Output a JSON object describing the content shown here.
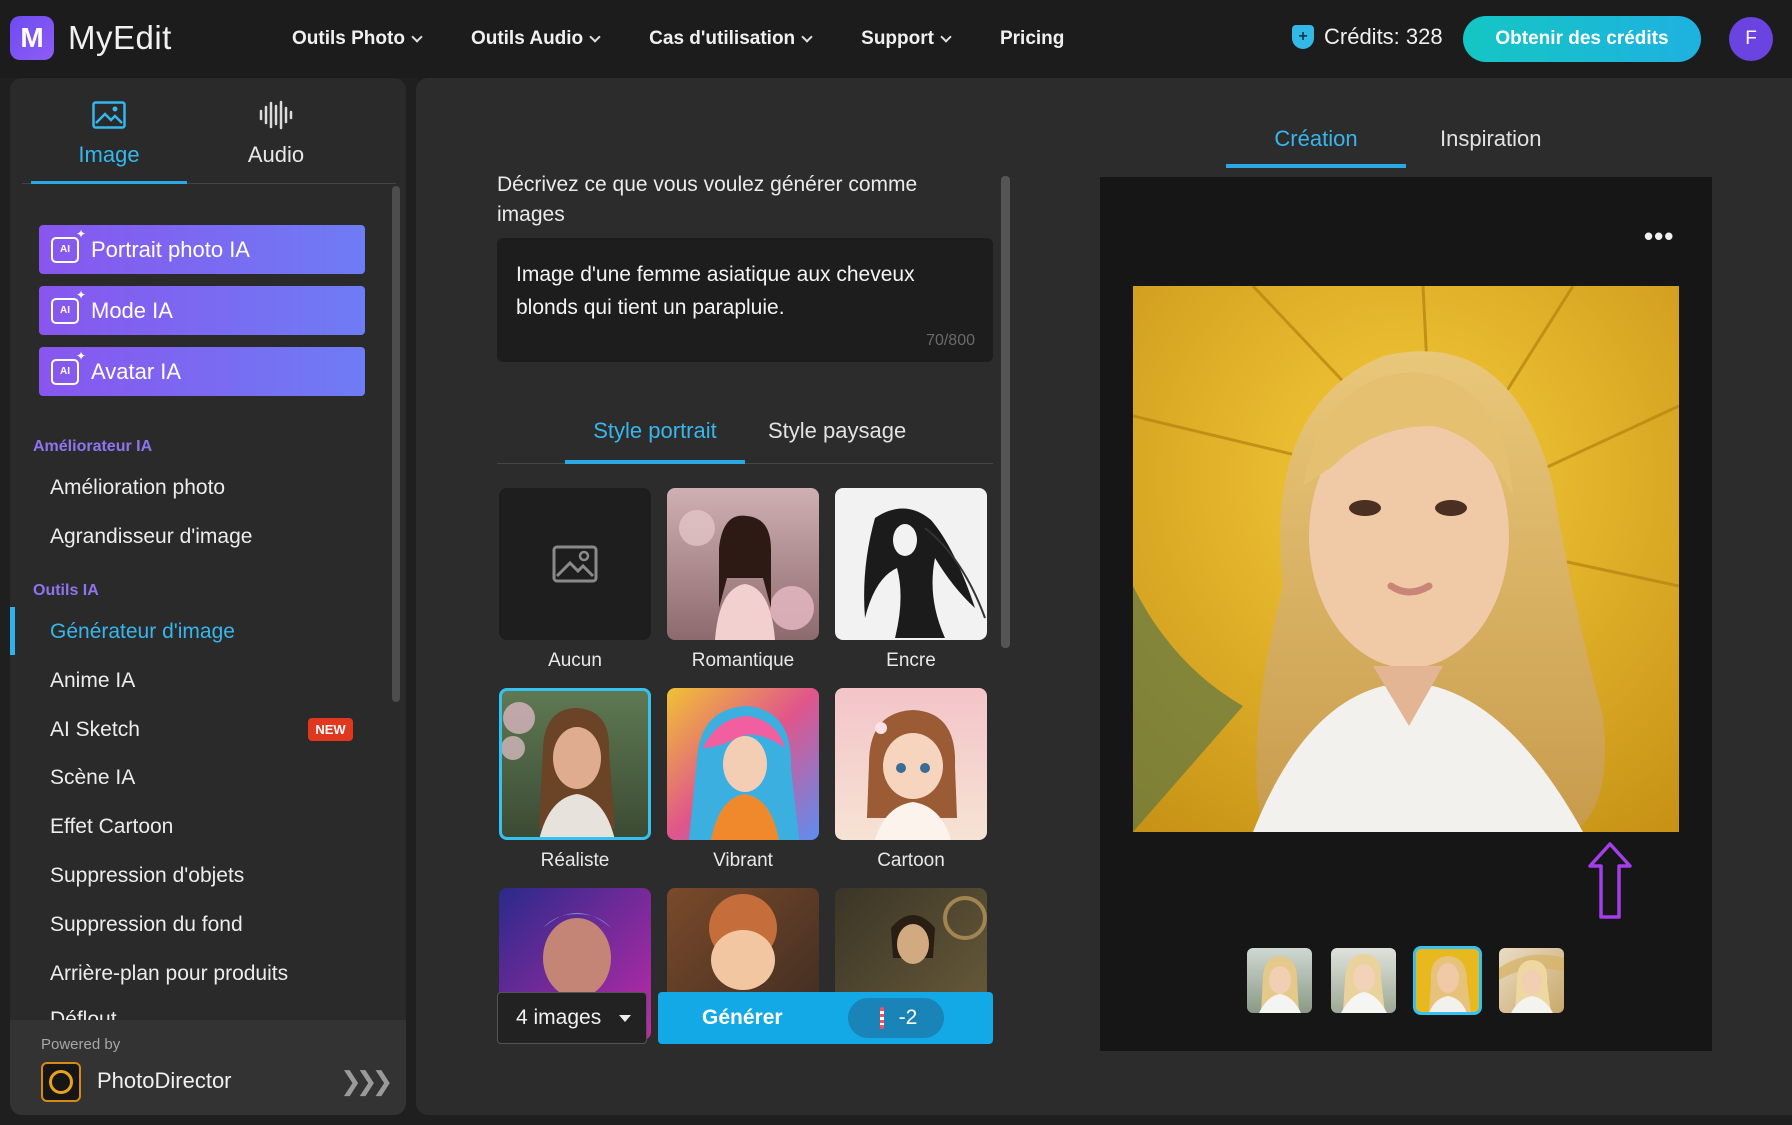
{
  "app": {
    "name": "MyEdit",
    "logo_letter": "M"
  },
  "nav": {
    "items": [
      "Outils Photo",
      "Outils Audio",
      "Cas d'utilisation",
      "Support"
    ],
    "pricing": "Pricing"
  },
  "header": {
    "credits": "Crédits: 328",
    "get_credits": "Obtenir des crédits",
    "avatar_letter": "F"
  },
  "sidebar": {
    "tabs": {
      "image": "Image",
      "audio": "Audio"
    },
    "ai_buttons": [
      "Portrait photo IA",
      "Mode IA",
      "Avatar IA"
    ],
    "ai_icon_text": "AI",
    "section_enhancer": "Améliorateur IA",
    "enhancer_items": [
      "Amélioration photo",
      "Agrandisseur d'image"
    ],
    "section_tools": "Outils IA",
    "tool_items": [
      "Générateur d'image",
      "Anime IA",
      "AI Sketch",
      "Scène IA",
      "Effet Cartoon",
      "Suppression d'objets",
      "Suppression du fond",
      "Arrière-plan pour produits",
      "Déflout..."
    ],
    "new_badge": "NEW",
    "powered_by": "Powered by",
    "powered_app": "PhotoDirector"
  },
  "prompt": {
    "label": "Décrivez ce que vous voulez générer comme images",
    "value": "Image d'une femme asiatique aux cheveux blonds qui tient un parapluie.",
    "count": "70/800"
  },
  "styles": {
    "tabs": {
      "portrait": "Style portrait",
      "landscape": "Style paysage"
    },
    "items": [
      "Aucun",
      "Romantique",
      "Encre",
      "Réaliste",
      "Vibrant",
      "Cartoon"
    ],
    "selected": "Réaliste"
  },
  "generate": {
    "count_label": "4 images",
    "button": "Générer",
    "cost": "-2"
  },
  "result": {
    "tabs": {
      "creation": "Création",
      "inspiration": "Inspiration"
    },
    "more": "•••",
    "thumbnail_count": 4,
    "selected_thumbnail": 3
  },
  "colors": {
    "accent": "#2aa9e4",
    "brand_purple": "#7a5af0",
    "new_badge": "#e0371e"
  }
}
